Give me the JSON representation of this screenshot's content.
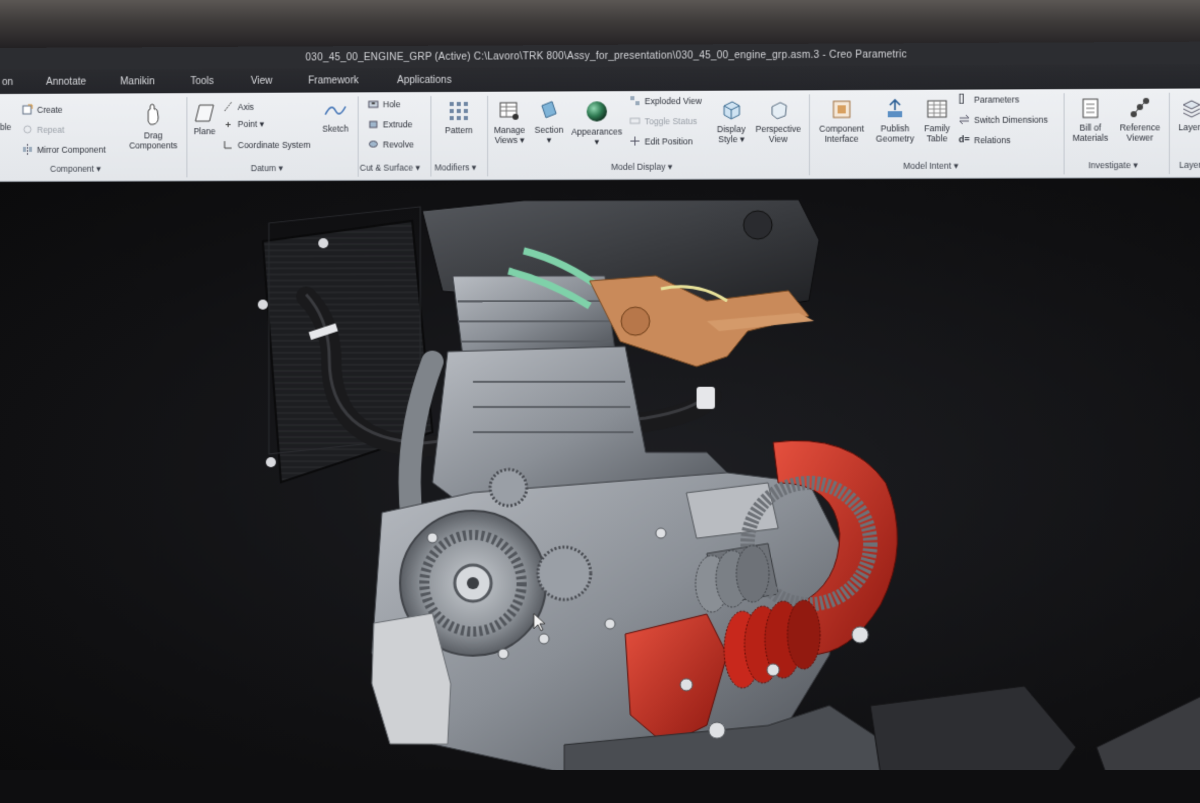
{
  "window": {
    "title": "030_45_00_ENGINE_GRP (Active) C:\\Lavoro\\TRK 800\\Assy_for_presentation\\030_45_00_engine_grp.asm.3 - Creo Parametric"
  },
  "menu": {
    "tabs": [
      "on",
      "Annotate",
      "Manikin",
      "Tools",
      "View",
      "Framework",
      "Applications"
    ]
  },
  "ribbon": {
    "component": {
      "create": "Create",
      "repeat": "Repeat",
      "mirror": "Mirror Component",
      "assemble_partial": "ble",
      "drag": [
        "Drag",
        "Components"
      ],
      "label": "Component ▾"
    },
    "datum": {
      "plane": "Plane",
      "axis": "Axis",
      "point": "Point ▾",
      "csys": "Coordinate System",
      "sketch": "Sketch",
      "label": "Datum ▾"
    },
    "cut_surface": {
      "hole": "Hole",
      "extrude": "Extrude",
      "revolve": "Revolve",
      "label": "Cut & Surface ▾"
    },
    "modifiers": {
      "pattern": "Pattern",
      "label": "Modifiers ▾"
    },
    "model_display": {
      "manage_views": [
        "Manage",
        "Views ▾"
      ],
      "section": [
        "Section",
        "▾"
      ],
      "appearances": [
        "Appearances",
        "▾"
      ],
      "exploded": "Exploded View",
      "toggle_status": "Toggle Status",
      "edit_position": "Edit Position",
      "display_style": [
        "Display",
        "Style ▾"
      ],
      "perspective": [
        "Perspective",
        "View"
      ],
      "label": "Model Display ▾"
    },
    "model_intent": {
      "component_interface": [
        "Component",
        "Interface"
      ],
      "publish_geometry": [
        "Publish",
        "Geometry"
      ],
      "family_table": [
        "Family",
        "Table"
      ],
      "parameters": "Parameters",
      "switch_dimensions": "Switch Dimensions",
      "relations": "Relations",
      "label": "Model Intent ▾"
    },
    "investigate": {
      "bom": [
        "Bill of",
        "Materials"
      ],
      "reference_viewer": [
        "Reference",
        "Viewer"
      ],
      "label": "Investigate ▾"
    },
    "layer": {
      "layers": "Layers",
      "label": "Layer"
    }
  },
  "colors": {
    "ribbon_bg": "#e6e9ed",
    "titlebar_bg": "#2c2d31",
    "viewport_bg": "#111113",
    "engine_grey": "#8c9096",
    "highlight_red": "#c8281c",
    "hose_green": "#7fd1a9",
    "copper": "#c98a5a"
  }
}
